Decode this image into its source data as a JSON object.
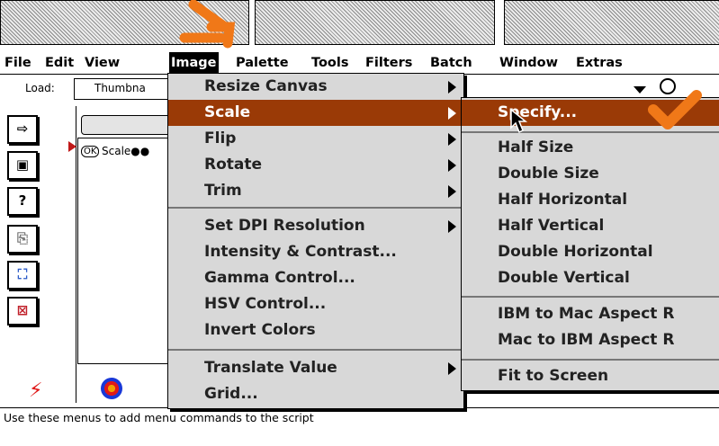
{
  "menubar": {
    "items": [
      "File",
      "Edit",
      "View",
      "Image",
      "Palette",
      "Tools",
      "Filters",
      "Batch",
      "Window",
      "Extras"
    ]
  },
  "toolbar": {
    "load_label": "Load:",
    "load_value": "Thumbna"
  },
  "script_list": {
    "step": "Scale●●",
    "ok_badge": "OK"
  },
  "image_menu": {
    "items": [
      {
        "label": "Resize Canvas",
        "submenu": true
      },
      {
        "label": "Scale",
        "submenu": true,
        "highlighted": true
      },
      {
        "label": "Flip",
        "submenu": true
      },
      {
        "label": "Rotate",
        "submenu": true
      },
      {
        "label": "Trim",
        "submenu": true
      },
      {
        "label": "Set DPI Resolution",
        "submenu": true
      },
      {
        "label": "Intensity & Contrast...",
        "submenu": false
      },
      {
        "label": "Gamma Control...",
        "submenu": false
      },
      {
        "label": "HSV Control...",
        "submenu": false
      },
      {
        "label": "Invert Colors",
        "submenu": false
      },
      {
        "label": "Translate Value",
        "submenu": true
      },
      {
        "label": "Grid...",
        "submenu": false
      }
    ]
  },
  "scale_submenu": {
    "items": [
      {
        "label": "Specify...",
        "highlighted": true
      },
      {
        "label": "Half Size"
      },
      {
        "label": "Double Size"
      },
      {
        "label": "Half Horizontal"
      },
      {
        "label": "Half Vertical"
      },
      {
        "label": "Double Horizontal"
      },
      {
        "label": "Double Vertical"
      },
      {
        "label": "IBM to Mac Aspect R"
      },
      {
        "label": "Mac to IBM Aspect R"
      },
      {
        "label": "Fit to Screen"
      }
    ]
  },
  "status": {
    "text": "Use these menus to add menu commands to the script"
  },
  "colors": {
    "highlight": "#9a3a06",
    "annotation": "#f07818",
    "menu_bg": "#d8d8d8"
  }
}
